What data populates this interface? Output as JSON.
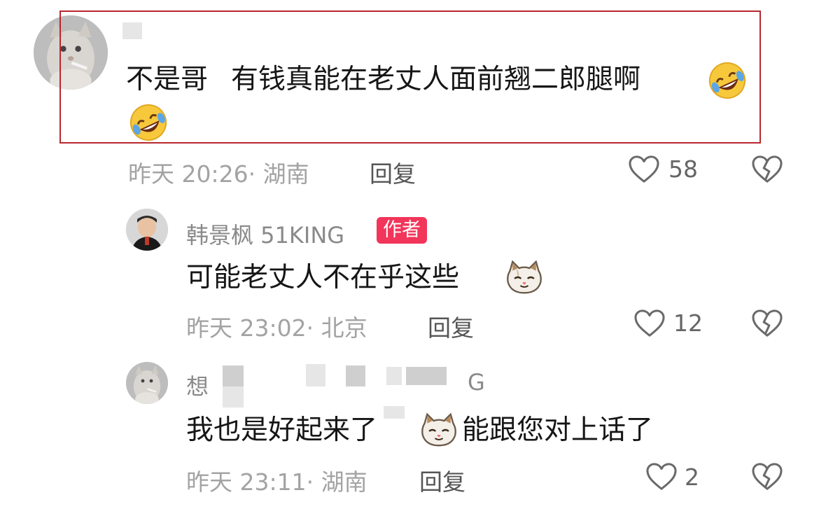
{
  "comments": [
    {
      "username": "",
      "text_part1": "不是哥",
      "text_part2": "有钱真能在老丈人面前翘二郎腿啊",
      "meta": "昨天 20:26· 湖南",
      "reply_label": "回复",
      "likes": "58",
      "emoji": "rofl-emoji"
    },
    {
      "username": "韩景枫 51KING",
      "badge": "作者",
      "text": "可能老丈人不在乎这些",
      "meta": "昨天 23:02· 北京",
      "reply_label": "回复",
      "likes": "12",
      "emoji": "cat-emoji"
    },
    {
      "username_start": "想",
      "username_end": "G",
      "text_part1": "我也是好起来了",
      "text_part2": "能跟您对上话了",
      "meta": "昨天 23:11· 湖南",
      "reply_label": "回复",
      "likes": "2",
      "emoji": "cat-emoji"
    }
  ],
  "colors": {
    "highlight_border": "#b8282e",
    "author_badge": "#f2355a",
    "meta_text": "#a3a3a3"
  }
}
